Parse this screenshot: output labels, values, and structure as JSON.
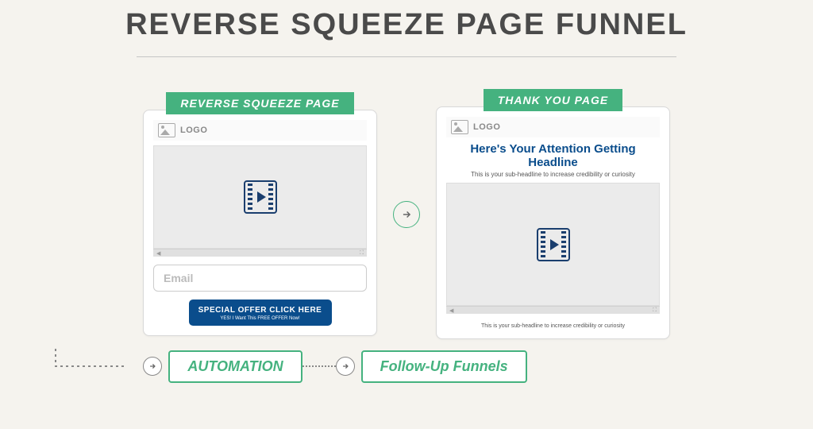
{
  "title": "REVERSE SQUEEZE PAGE FUNNEL",
  "pages": {
    "squeeze": {
      "label": "REVERSE SQUEEZE PAGE",
      "logo": "LOGO",
      "email_placeholder": "Email",
      "cta_main": "SPECIAL OFFER CLICK HERE",
      "cta_sub": "YES! I Want This FREE OFFER Now!"
    },
    "thankyou": {
      "label": "THANK YOU PAGE",
      "logo": "LOGO",
      "headline": "Here's Your Attention Getting Headline",
      "subheadline": "This is your sub-headline to increase credibility or curiosity",
      "footer": "This is your sub-headline to increase credibility or curiosity"
    }
  },
  "flow": {
    "automation": "AUTOMATION",
    "followup": "Follow-Up Funnels"
  }
}
